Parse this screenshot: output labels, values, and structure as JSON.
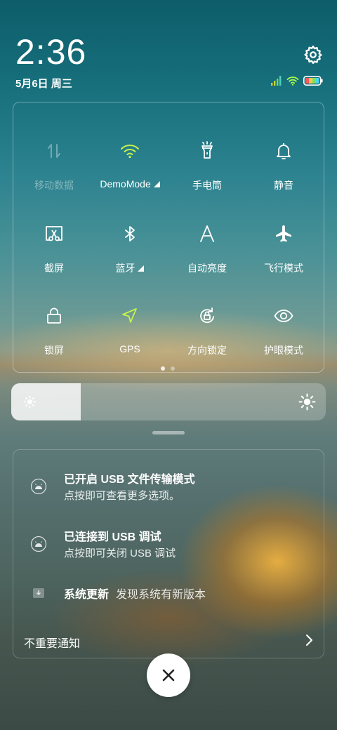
{
  "header": {
    "time": "2:36",
    "date": "5月6日 周三"
  },
  "colors": {
    "active_accent": "#c6f24a",
    "wifi_status": "#a6ff4e",
    "signal_bar": "#ffc000"
  },
  "quick_settings": {
    "tiles": [
      {
        "label": "移动数据",
        "icon": "mobile-data-icon",
        "state": "disabled"
      },
      {
        "label": "DemoMode",
        "icon": "wifi-icon",
        "state": "active",
        "has_more": true
      },
      {
        "label": "手电筒",
        "icon": "flashlight-icon",
        "state": "off"
      },
      {
        "label": "静音",
        "icon": "bell-icon",
        "state": "off"
      },
      {
        "label": "截屏",
        "icon": "screenshot-icon",
        "state": "off"
      },
      {
        "label": "蓝牙",
        "icon": "bluetooth-icon",
        "state": "off",
        "has_more": true
      },
      {
        "label": "自动亮度",
        "icon": "auto-brightness-icon",
        "state": "off"
      },
      {
        "label": "飞行模式",
        "icon": "airplane-icon",
        "state": "off"
      },
      {
        "label": "锁屏",
        "icon": "lock-icon",
        "state": "off"
      },
      {
        "label": "GPS",
        "icon": "location-icon",
        "state": "active"
      },
      {
        "label": "方向锁定",
        "icon": "rotation-lock-icon",
        "state": "off"
      },
      {
        "label": "护眼模式",
        "icon": "eye-icon",
        "state": "off"
      }
    ],
    "page_count": 2,
    "current_page": 1
  },
  "brightness": {
    "level": 0.22
  },
  "notifications": [
    {
      "title": "已开启 USB 文件传输模式",
      "subtitle": "点按即可查看更多选项。",
      "icon": "android-icon"
    },
    {
      "title": "已连接到 USB 调试",
      "subtitle": "点按即可关闭 USB 调试",
      "icon": "android-icon"
    },
    {
      "title": "系统更新",
      "subtitle": "发现系统有新版本",
      "icon": "update-icon"
    }
  ],
  "footer": {
    "unimportant_label": "不重要通知"
  }
}
